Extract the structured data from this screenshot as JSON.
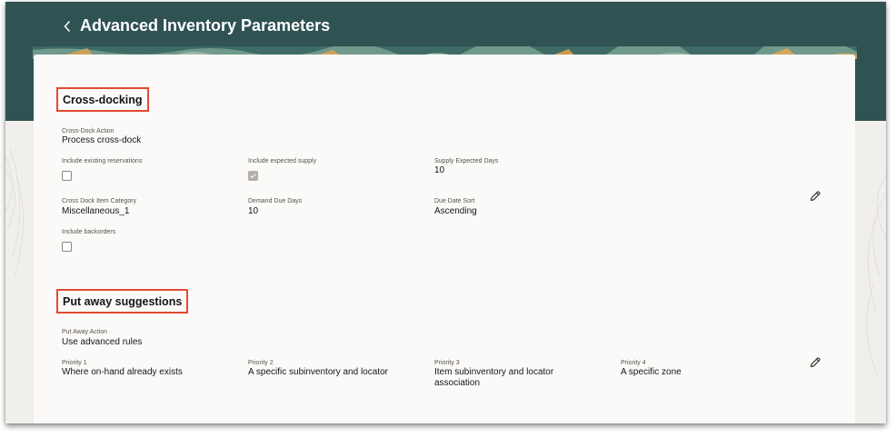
{
  "header": {
    "title": "Advanced Inventory Parameters",
    "back_icon": "chevron-left-icon"
  },
  "cross_docking": {
    "title": "Cross-docking",
    "action_label": "Cross-Dock Action",
    "action_value": "Process cross-dock",
    "include_existing_reservations_label": "Include existing reservations",
    "include_existing_reservations_checked": false,
    "include_expected_supply_label": "Include expected supply",
    "include_expected_supply_checked": true,
    "supply_expected_days_label": "Supply Expected Days",
    "supply_expected_days_value": "10",
    "item_category_label": "Cross Dock Item Category",
    "item_category_value": "Miscellaneous_1",
    "demand_due_days_label": "Demand Due Days",
    "demand_due_days_value": "10",
    "due_date_sort_label": "Due Date Sort",
    "due_date_sort_value": "Ascending",
    "include_backorders_label": "Include backorders",
    "include_backorders_checked": false,
    "edit_icon": "pencil-icon"
  },
  "put_away": {
    "title": "Put away suggestions",
    "action_label": "Put Away Action",
    "action_value": "Use advanced rules",
    "priority_1_label": "Priority 1",
    "priority_1_value": "Where on-hand already exists",
    "priority_2_label": "Priority 2",
    "priority_2_value": "A specific subinventory and locator",
    "priority_3_label": "Priority 3",
    "priority_3_value": "Item subinventory and locator association",
    "priority_4_label": "Priority 4",
    "priority_4_value": "A specific zone",
    "edit_icon": "pencil-icon"
  },
  "colors": {
    "banner": "#2f5253",
    "highlight_box": "#e24a33",
    "card": "#fbfaf8",
    "page_background": "#f1efec"
  }
}
